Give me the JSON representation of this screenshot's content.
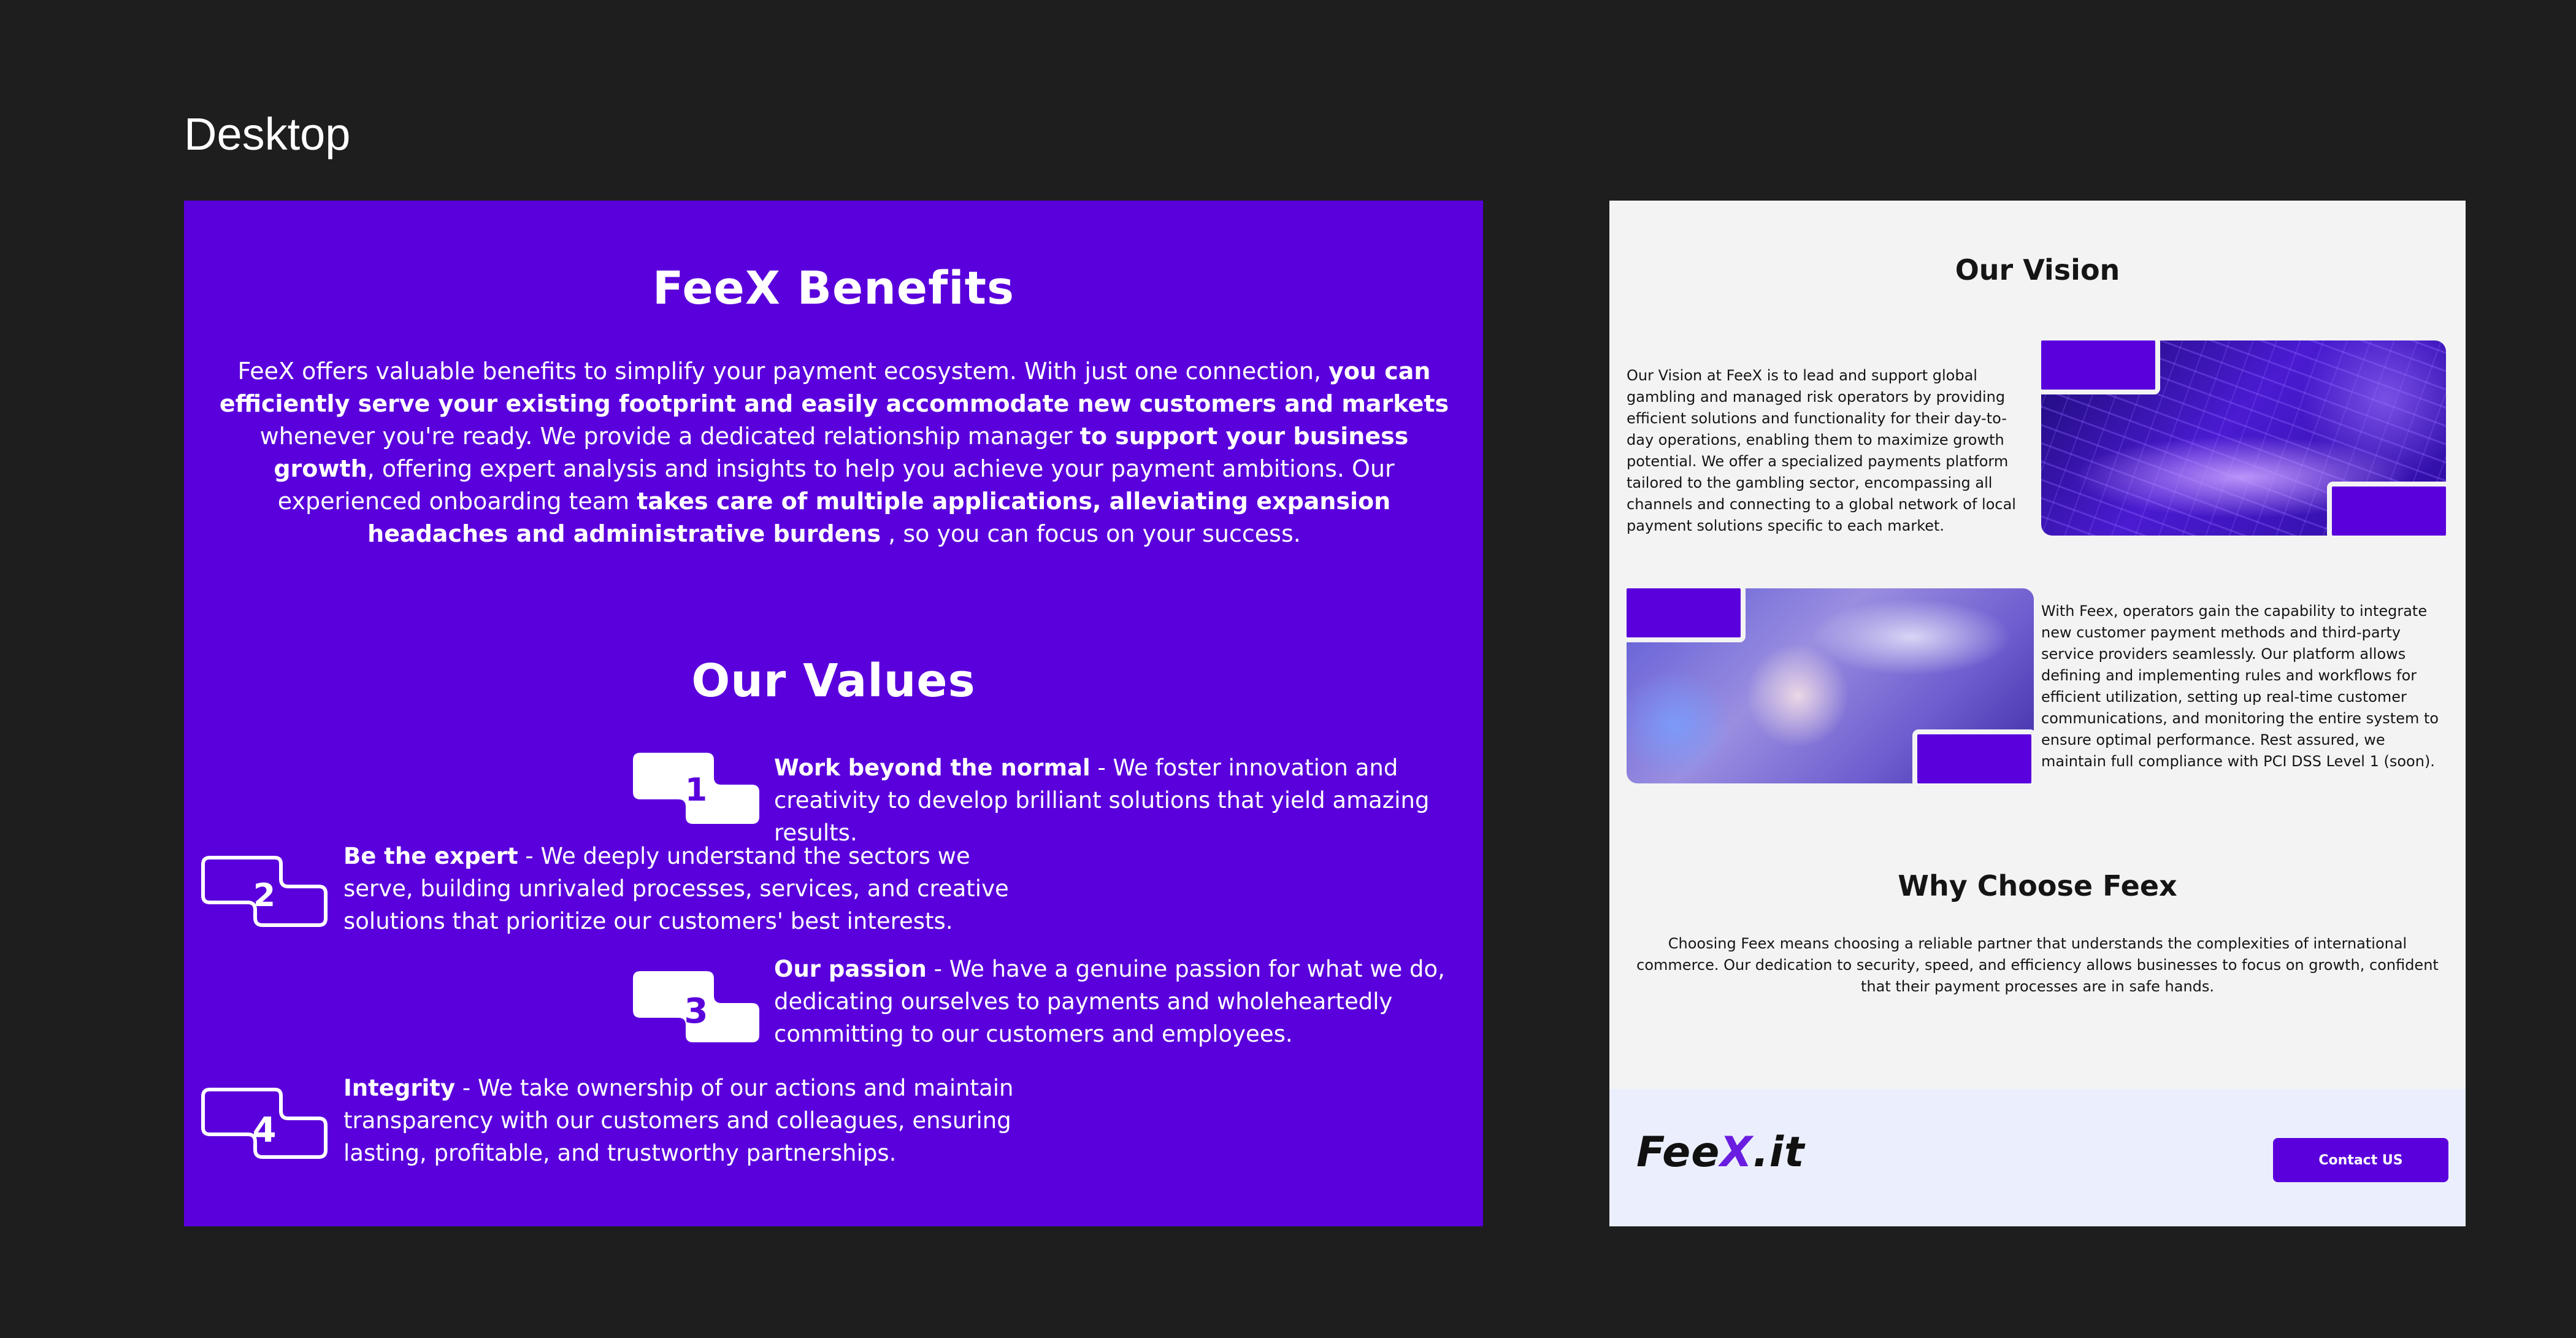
{
  "canvas": {
    "frame_label": "Desktop"
  },
  "benefits": {
    "title": "FeeX Benefits",
    "paragraph": [
      {
        "t": "FeeX offers valuable benefits to simplify your payment ecosystem. With just one connection, ",
        "b": false
      },
      {
        "t": "you can efficiently serve your existing footprint and easily accommodate new customers and markets",
        "b": true
      },
      {
        "t": " whenever you're ready. We provide a dedicated relationship manager ",
        "b": false
      },
      {
        "t": "to support your business growth",
        "b": true
      },
      {
        "t": ", offering expert analysis and insights to help you achieve your payment ambitions. Our experienced onboarding team ",
        "b": false
      },
      {
        "t": "takes care of multiple applications, alleviating expansion headaches and administrative burdens",
        "b": true
      },
      {
        "t": " , so you can focus on your success.",
        "b": false
      }
    ]
  },
  "values": {
    "title": "Our Values",
    "items": [
      {
        "num": "1",
        "heading": "Work beyond the normal",
        "text": " - We foster innovation and creativity to develop brilliant solutions that yield amazing results."
      },
      {
        "num": "2",
        "heading": "Be the expert",
        "text": " - We deeply understand the sectors we serve, building unrivaled processes, services, and creative solutions that prioritize our customers' best interests."
      },
      {
        "num": "3",
        "heading": "Our passion",
        "text": " - We have a genuine passion for what we do, dedicating ourselves to payments and wholeheartedly committing to our customers and employees."
      },
      {
        "num": "4",
        "heading": "Integrity",
        "text": " - We take ownership of our actions and maintain transparency with our customers and colleagues, ensuring lasting, profitable, and trustworthy partnerships."
      }
    ]
  },
  "vision": {
    "title": "Our Vision",
    "text": "Our Vision at FeeX is to lead and support global gambling and managed risk operators by providing efficient solutions and functionality for their day-to-day operations, enabling them to maximize growth potential. We offer a specialized payments platform tailored to the gambling sector, encompassing all channels and connecting to a global network of local payment solutions specific to each market.",
    "feex_text": "With Feex, operators gain the capability to integrate new customer payment methods and third-party service providers seamlessly. Our platform allows defining and implementing rules and workflows for efficient utilization, setting up real-time customer communications, and monitoring the entire system to ensure optimal performance. Rest assured, we maintain full compliance with PCI DSS Level 1 (soon)."
  },
  "why": {
    "title": "Why Choose Feex",
    "text": "Choosing Feex means choosing a reliable partner that understands the complexities of international commerce. Our dedication to security, speed, and efficiency allows businesses to focus on growth, confident that their payment processes are in safe hands."
  },
  "footer": {
    "logo_left": "Fee",
    "logo_x": "X",
    "logo_right": ".it",
    "contact_label": "Contact US"
  },
  "colors": {
    "brand_purple": "#5a00dc",
    "canvas_bg": "#1e1e1e",
    "right_frame_bg": "#f3f3f3",
    "footer_bg": "#ebeffd"
  }
}
